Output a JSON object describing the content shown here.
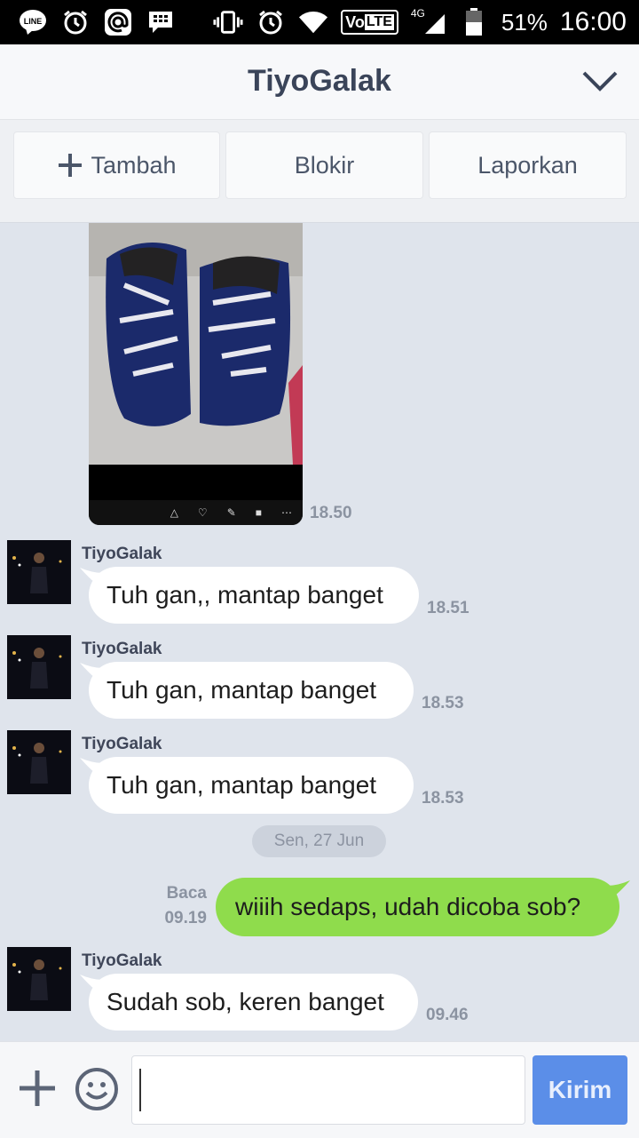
{
  "status_bar": {
    "battery": "51%",
    "time": "16:00",
    "network": "4G",
    "volte": "LTE",
    "volte_prefix": "Vo",
    "icons_left": [
      "line-icon",
      "alarm-icon",
      "at-icon",
      "bbm-icon"
    ],
    "icons_right": [
      "vibrate-icon",
      "alarm-icon",
      "wifi-icon",
      "volte-icon",
      "signal-icon",
      "battery-icon"
    ]
  },
  "header": {
    "title": "TiyoGalak"
  },
  "actions": {
    "add_label": "Tambah",
    "add_icon": "plus-icon",
    "block_label": "Blokir",
    "report_label": "Laporkan"
  },
  "messages": [
    {
      "type": "image",
      "time": "18.50"
    },
    {
      "type": "text",
      "sender": "TiyoGalak",
      "text": "Tuh gan,, mantap banget",
      "time": "18.51"
    },
    {
      "type": "text",
      "sender": "TiyoGalak",
      "text": "Tuh gan, mantap banget",
      "time": "18.53"
    },
    {
      "type": "text",
      "sender": "TiyoGalak",
      "text": "Tuh gan, mantap banget",
      "time": "18.53"
    },
    {
      "type": "date",
      "text": "Sen, 27 Jun"
    },
    {
      "type": "outgoing",
      "text": "wiiih sedaps, udah dicoba sob?",
      "status": "Baca",
      "time": "09.19"
    },
    {
      "type": "text",
      "sender": "TiyoGalak",
      "text": "Sudah sob, keren banget",
      "time": "09.46"
    }
  ],
  "input": {
    "placeholder": "",
    "send_label": "Kirim"
  },
  "colors": {
    "outgoing_bubble": "#8fdc4c",
    "send_button": "#5b8ee8",
    "chat_bg": "#dfe4ec"
  }
}
